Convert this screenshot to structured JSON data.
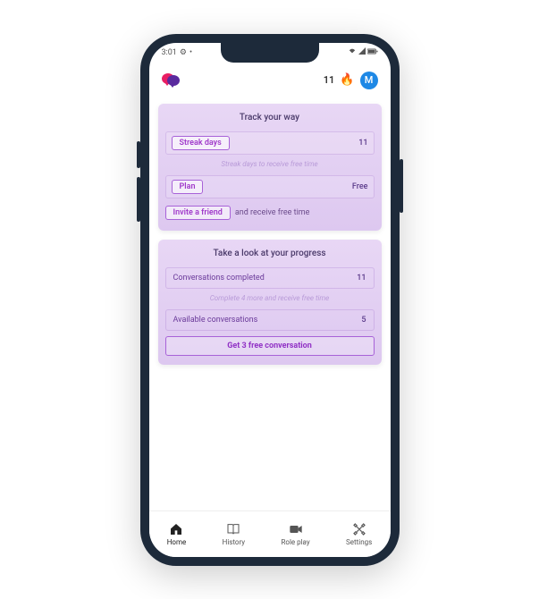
{
  "status": {
    "time": "3:01",
    "gear": "⚙",
    "dot": "•"
  },
  "header": {
    "streak": "11",
    "avatar_initial": "M"
  },
  "card1": {
    "title": "Track your way",
    "streak_label": "Streak days",
    "streak_value": "11",
    "streak_hint": "Streak days to receive free time",
    "plan_label": "Plan",
    "plan_value": "Free",
    "invite_label": "Invite a friend",
    "invite_text": "and receive free time"
  },
  "card2": {
    "title": "Take a look at your progress",
    "conv_label": "Conversations completed",
    "conv_value": "11",
    "conv_hint": "Complete 4 more and receive free time",
    "avail_label": "Available conversations",
    "avail_value": "5",
    "cta": "Get 3 free conversation"
  },
  "nav": {
    "home": "Home",
    "history": "History",
    "roleplay": "Role play",
    "settings": "Settings"
  }
}
